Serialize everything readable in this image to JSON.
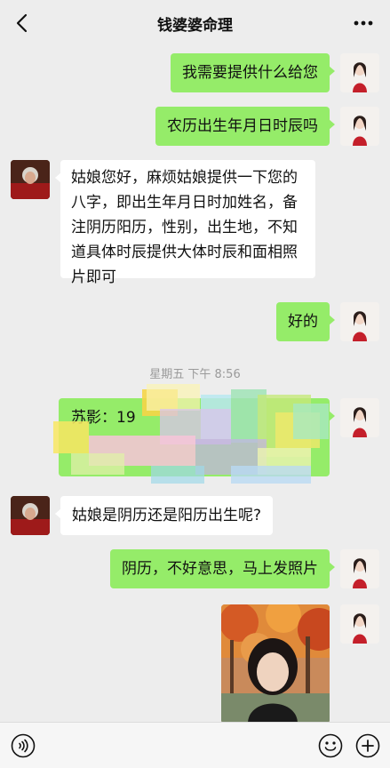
{
  "header": {
    "title": "钱婆婆命理",
    "back_icon": "chevron-left-icon",
    "more_icon": "more-horizontal-icon"
  },
  "messages": [
    {
      "from": "me",
      "text": "我需要提供什么给您"
    },
    {
      "from": "me",
      "text": "农历出生年月日时辰吗"
    },
    {
      "from": "master",
      "text": "姑娘您好，麻烦姑娘提供一下您的八字，即出生年月日时加姓名，备注阴历阳历，性别，出生地，不知道具体时辰提供大体时辰和面相照片即可"
    },
    {
      "from": "me",
      "text": "好的"
    },
    {
      "from": "me",
      "text_visible": "苏影：19",
      "note": "partially obscured"
    },
    {
      "from": "master",
      "text": "姑娘是阴历还是阳历出生呢?"
    },
    {
      "from": "me",
      "text": "阴历，不好意思，马上发照片"
    },
    {
      "from": "me",
      "type": "image"
    }
  ],
  "timestamp": "星期五 下午 8:56",
  "input_bar": {
    "voice_icon": "voice-icon",
    "emoji_icon": "emoji-icon",
    "plus_icon": "plus-circle-icon"
  },
  "colors": {
    "background": "#ededed",
    "my_bubble": "#95ec69",
    "their_bubble": "#ffffff",
    "timestamp_text": "#9a9a9a"
  }
}
